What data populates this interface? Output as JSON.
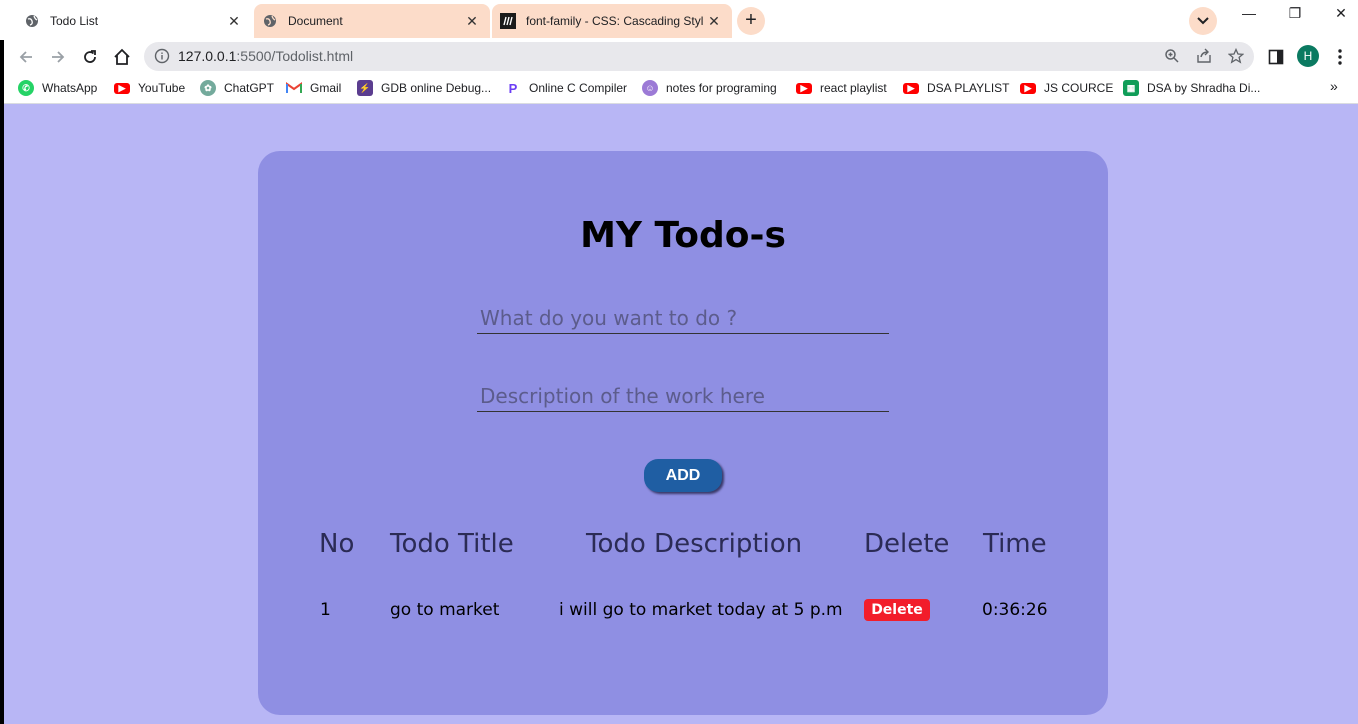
{
  "browser": {
    "tabs": [
      {
        "title": "Todo List",
        "active": true
      },
      {
        "title": "Document",
        "active": false
      },
      {
        "title": "font-family - CSS: Cascading Styl",
        "active": false
      }
    ],
    "url_host": "127.0.0.1",
    "url_path": ":5500/Todolist.html",
    "profile_initial": "H",
    "bookmarks": [
      {
        "label": "WhatsApp",
        "icon": "whatsapp-icon",
        "color": "#25d366"
      },
      {
        "label": "YouTube",
        "icon": "youtube-icon",
        "color": "#ff0000"
      },
      {
        "label": "ChatGPT",
        "icon": "chatgpt-icon",
        "color": "#74aa9c"
      },
      {
        "label": "Gmail",
        "icon": "gmail-icon",
        "color": "#ea4335"
      },
      {
        "label": "GDB online Debug...",
        "icon": "gdb-icon",
        "color": "#5b3d8f"
      },
      {
        "label": "Online C Compiler",
        "icon": "programiz-icon",
        "color": "#6b3df5"
      },
      {
        "label": "notes for programing",
        "icon": "notes-avatar-icon",
        "color": "#9c7ad6"
      },
      {
        "label": "react playlist",
        "icon": "youtube-icon",
        "color": "#ff0000"
      },
      {
        "label": "DSA  PLAYLIST",
        "icon": "youtube-icon",
        "color": "#ff0000"
      },
      {
        "label": "JS  COURCE",
        "icon": "youtube-icon",
        "color": "#ff0000"
      },
      {
        "label": "DSA by Shradha Di...",
        "icon": "sheets-icon",
        "color": "#0f9d58"
      }
    ]
  },
  "page": {
    "heading": "MY Todo-s",
    "title_placeholder": "What do you want to do ?",
    "desc_placeholder": "Description of the work here",
    "add_label": "ADD",
    "table": {
      "headers": [
        "No",
        "Todo Title",
        "Todo Description",
        "Delete",
        "Time"
      ],
      "rows": [
        {
          "no": "1",
          "title": "go to market",
          "description": "i will go to market today at 5 p.m",
          "delete_label": "Delete",
          "time": "0:36:26"
        }
      ]
    },
    "colors": {
      "background": "#b8b6f5",
      "card": "#8f8fe3",
      "add_button": "#1f5ea3",
      "delete_button": "#f21d2a"
    }
  }
}
